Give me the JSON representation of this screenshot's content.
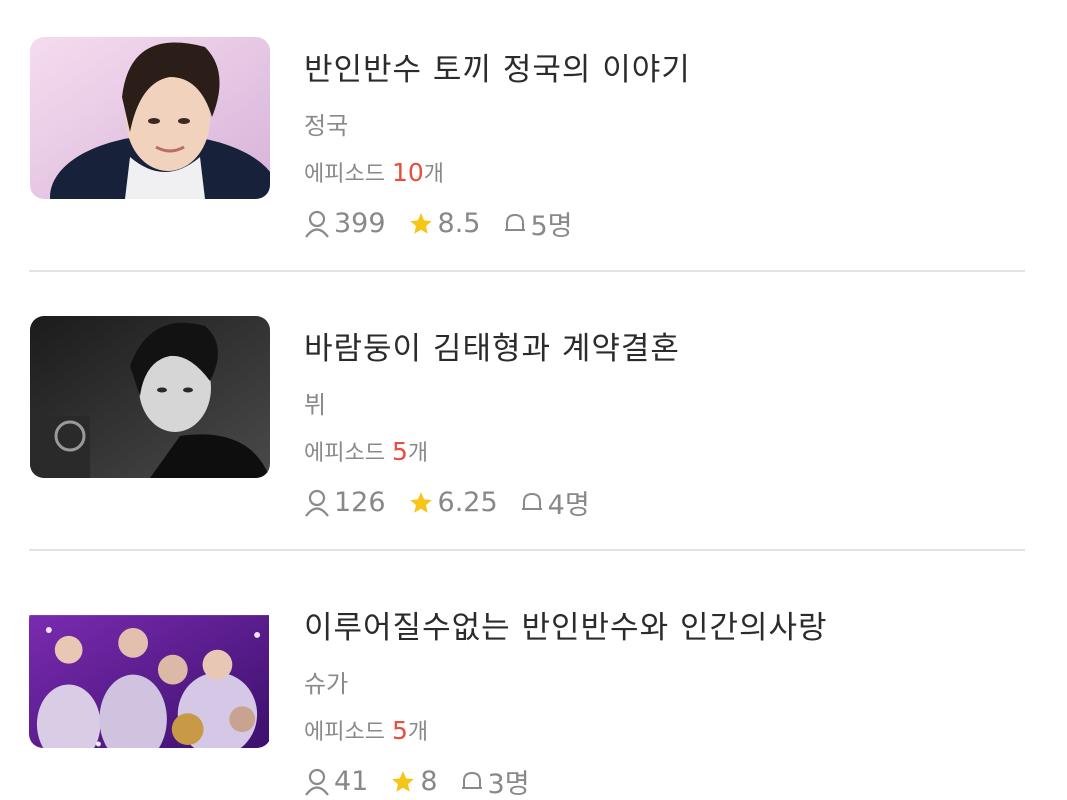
{
  "items": [
    {
      "title": "반인반수 토끼 정국의 이야기",
      "author": "정국",
      "episodes_label": "에피소드",
      "episodes_count": "10",
      "episodes_unit": "개",
      "views": "399",
      "rating": "8.5",
      "subscribers": "5명",
      "thumb_palette": [
        "#f4d6ea",
        "#d8b5dc"
      ]
    },
    {
      "title": "바람둥이 김태형과 계약결혼",
      "author": "뷔",
      "episodes_label": "에피소드",
      "episodes_count": "5",
      "episodes_unit": "개",
      "views": "126",
      "rating": "6.25",
      "subscribers": "4명",
      "thumb_palette": [
        "#1a1a1a",
        "#8c8c8c"
      ]
    },
    {
      "title": "이루어질수없는 반인반수와 인간의사랑",
      "author": "슈가",
      "episodes_label": "에피소드",
      "episodes_count": "5",
      "episodes_unit": "개",
      "views": "41",
      "rating": "8",
      "subscribers": "3명",
      "thumb_palette": [
        "#5b1f8f",
        "#c89ae8"
      ]
    }
  ],
  "icons": {
    "views": "person-icon",
    "rating": "star-icon",
    "subscribers": "bell-icon"
  },
  "colors": {
    "episode_count": "#e84d3d",
    "star": "#f5c518",
    "meta_text": "#8a8a8a",
    "title_text": "#2b2b2b"
  }
}
